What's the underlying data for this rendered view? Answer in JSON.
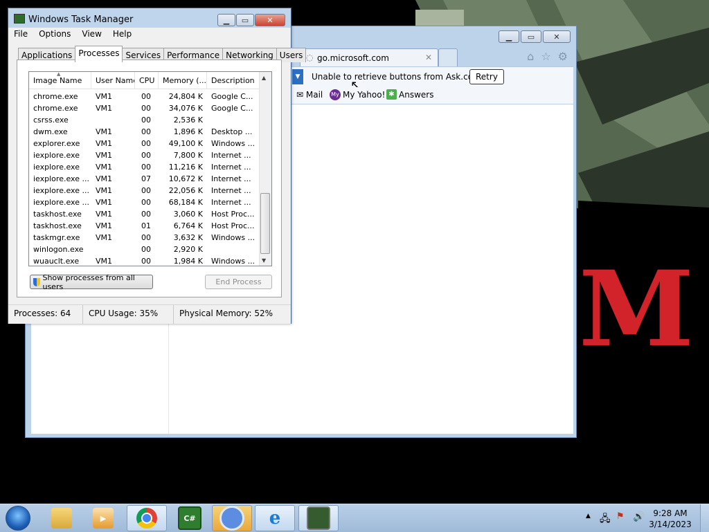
{
  "task_manager": {
    "title": "Windows Task Manager",
    "menu": [
      "File",
      "Options",
      "View",
      "Help"
    ],
    "tabs": [
      "Applications",
      "Processes",
      "Services",
      "Performance",
      "Networking",
      "Users"
    ],
    "active_tab": "Processes",
    "columns": [
      "Image Name",
      "User Name",
      "CPU",
      "Memory (...",
      "Description"
    ],
    "rows": [
      {
        "image": "chrome.exe",
        "user": "VM1",
        "cpu": "00",
        "memory": "24,804 K",
        "desc": "Google C..."
      },
      {
        "image": "chrome.exe",
        "user": "VM1",
        "cpu": "00",
        "memory": "34,076 K",
        "desc": "Google C..."
      },
      {
        "image": "csrss.exe",
        "user": "",
        "cpu": "00",
        "memory": "2,536 K",
        "desc": ""
      },
      {
        "image": "dwm.exe",
        "user": "VM1",
        "cpu": "00",
        "memory": "1,896 K",
        "desc": "Desktop ..."
      },
      {
        "image": "explorer.exe",
        "user": "VM1",
        "cpu": "00",
        "memory": "49,100 K",
        "desc": "Windows ..."
      },
      {
        "image": "iexplore.exe",
        "user": "VM1",
        "cpu": "00",
        "memory": "7,800 K",
        "desc": "Internet ..."
      },
      {
        "image": "iexplore.exe",
        "user": "VM1",
        "cpu": "00",
        "memory": "11,216 K",
        "desc": "Internet ..."
      },
      {
        "image": "iexplore.exe ...",
        "user": "VM1",
        "cpu": "07",
        "memory": "10,672 K",
        "desc": "Internet ..."
      },
      {
        "image": "iexplore.exe ...",
        "user": "VM1",
        "cpu": "00",
        "memory": "22,056 K",
        "desc": "Internet ..."
      },
      {
        "image": "iexplore.exe ...",
        "user": "VM1",
        "cpu": "00",
        "memory": "68,184 K",
        "desc": "Internet ..."
      },
      {
        "image": "taskhost.exe",
        "user": "VM1",
        "cpu": "00",
        "memory": "3,060 K",
        "desc": "Host Proc..."
      },
      {
        "image": "taskhost.exe",
        "user": "VM1",
        "cpu": "01",
        "memory": "6,764 K",
        "desc": "Host Proc..."
      },
      {
        "image": "taskmgr.exe",
        "user": "VM1",
        "cpu": "00",
        "memory": "3,632 K",
        "desc": "Windows ..."
      },
      {
        "image": "winlogon.exe",
        "user": "",
        "cpu": "00",
        "memory": "2,920 K",
        "desc": ""
      },
      {
        "image": "wuauclt.exe",
        "user": "VM1",
        "cpu": "00",
        "memory": "1,984 K",
        "desc": "Windows ..."
      }
    ],
    "show_all_label": "Show processes from all users",
    "end_process_label": "End Process",
    "status": {
      "processes": "Processes: 64",
      "cpu": "CPU Usage: 35%",
      "memory": "Physical Memory: 52%"
    }
  },
  "browser": {
    "tab_title": "go.microsoft.com",
    "notice": "Unable to retrieve buttons from Ask.com.",
    "retry_label": "Retry",
    "favorites": [
      "Mail",
      "My Yahoo!",
      "Answers"
    ]
  },
  "taskbar": {
    "apps": [
      "explorer",
      "media-player",
      "chrome",
      "csharp",
      "chrome-alt",
      "internet-explorer",
      "task-manager"
    ],
    "time": "9:28 AM",
    "date": "3/14/2023"
  },
  "wallpaper": {
    "letters": "M"
  },
  "colors": {
    "window_frame": "#bfd5ec",
    "wallpaper_red": "#d2222a",
    "wallpaper_green": "#4d5e48"
  }
}
